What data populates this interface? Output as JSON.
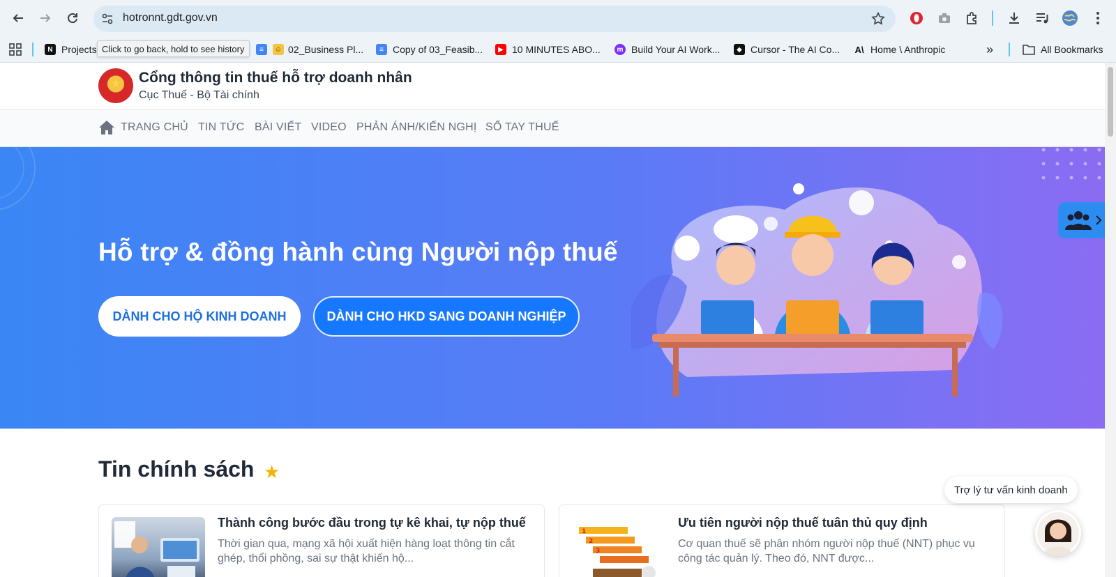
{
  "browser": {
    "url": "hotronnt.gdt.gov.vn",
    "tooltip": "Click to go back, hold to see history",
    "bookmarks": [
      {
        "label": "Projects",
        "icon": "notion-icon"
      },
      {
        "label": "02_Business Pl...",
        "icon": "docs-icon"
      },
      {
        "label": "Copy of 03_Feasib...",
        "icon": "docs-icon"
      },
      {
        "label": "10 MINUTES ABO...",
        "icon": "youtube-icon"
      },
      {
        "label": "Build Your AI Work...",
        "icon": "make-icon"
      },
      {
        "label": "Cursor - The AI Co...",
        "icon": "cursor-icon"
      },
      {
        "label": "Home \\ Anthropic",
        "icon": "anthropic-icon"
      }
    ],
    "all_bookmarks": "All Bookmarks",
    "more": "»"
  },
  "site": {
    "title": "Cổng thông tin thuế hỗ trợ doanh nhân",
    "subtitle": "Cục Thuế - Bộ Tài chính",
    "nav": [
      "TRANG CHỦ",
      "TIN TỨC",
      "BÀI VIẾT",
      "VIDEO",
      "PHẢN ÁNH/KIẾN NGHỊ",
      "SỔ TAY THUẾ"
    ]
  },
  "hero": {
    "title": "Hỗ trợ & đồng hành cùng Người nộp thuế",
    "btn_household": "DÀNH CHO HỘ KINH DOANH",
    "btn_enterprise": "DÀNH CHO HKD SANG DOANH NGHIỆP"
  },
  "section": {
    "title": "Tin chính sách"
  },
  "cards": [
    {
      "title": "Thành công bước đầu trong tự kê khai, tự nộp thuế",
      "desc": "Thời gian qua, mạng xã hội xuất hiện hàng loạt thông tin cắt ghép, thổi phồng, sai sự thật khiến hộ..."
    },
    {
      "title": "Ưu tiên người nộp thuế tuân thủ quy định",
      "desc": "Cơ quan thuế sẽ phân nhóm người nộp thuế (NNT) phục vụ công tác quản lý. Theo đó, NNT được..."
    }
  ],
  "assistant": {
    "label": "Trợ lý tư vấn kinh doanh"
  },
  "colors": {
    "hero_start": "#3a86f5",
    "hero_end": "#8b6cf3",
    "primary_button": "#1677ff",
    "accent_star": "#f4b400"
  }
}
